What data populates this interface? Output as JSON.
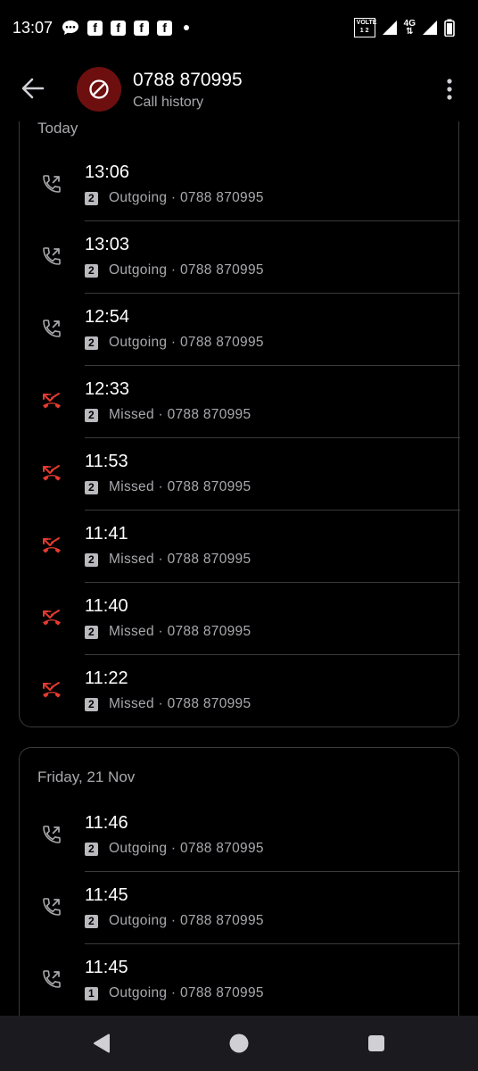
{
  "status_bar": {
    "time": "13:07",
    "volte_top": "VOLTE",
    "volte_bottom": "1 2",
    "network": "4G"
  },
  "header": {
    "title": "0788 870995",
    "subtitle": "Call history",
    "avatar_icon": "blocked-icon",
    "avatar_color": "#6e0f0f"
  },
  "colors": {
    "missed": "#e63a2f",
    "outgoing": "#a9a9ae",
    "card_border": "#3a3a3e"
  },
  "sections": [
    {
      "date": "Today",
      "calls": [
        {
          "time": "13:06",
          "type": "outgoing",
          "sim": "2",
          "label": "Outgoing · 0788 870995"
        },
        {
          "time": "13:03",
          "type": "outgoing",
          "sim": "2",
          "label": "Outgoing · 0788 870995"
        },
        {
          "time": "12:54",
          "type": "outgoing",
          "sim": "2",
          "label": "Outgoing · 0788 870995"
        },
        {
          "time": "12:33",
          "type": "missed",
          "sim": "2",
          "label": "Missed · 0788 870995"
        },
        {
          "time": "11:53",
          "type": "missed",
          "sim": "2",
          "label": "Missed · 0788 870995"
        },
        {
          "time": "11:41",
          "type": "missed",
          "sim": "2",
          "label": "Missed · 0788 870995"
        },
        {
          "time": "11:40",
          "type": "missed",
          "sim": "2",
          "label": "Missed · 0788 870995"
        },
        {
          "time": "11:22",
          "type": "missed",
          "sim": "2",
          "label": "Missed · 0788 870995"
        }
      ]
    },
    {
      "date": "Friday, 21 Nov",
      "calls": [
        {
          "time": "11:46",
          "type": "outgoing",
          "sim": "2",
          "label": "Outgoing · 0788 870995"
        },
        {
          "time": "11:45",
          "type": "outgoing",
          "sim": "2",
          "label": "Outgoing · 0788 870995"
        },
        {
          "time": "11:45",
          "type": "outgoing",
          "sim": "1",
          "label": "Outgoing · 0788 870995"
        }
      ]
    }
  ]
}
